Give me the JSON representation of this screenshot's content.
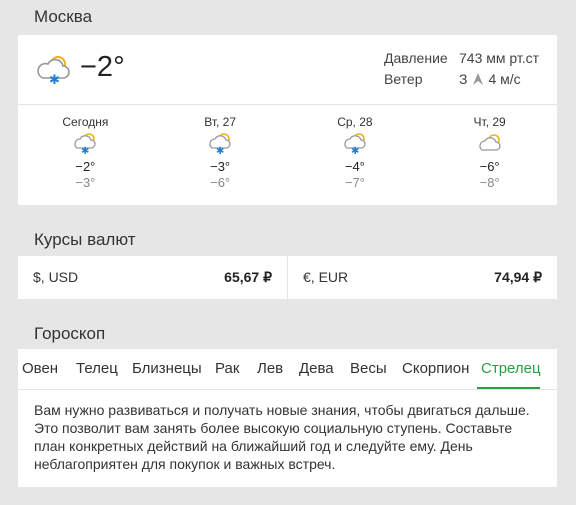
{
  "weather": {
    "city": "Москва",
    "current_temp": "−2°",
    "current_icon": "cloud-snow-sun-icon",
    "pressure_label": "Давление",
    "pressure_value": "743 мм рт.ст",
    "wind_label": "Ветер",
    "wind_dir": "З",
    "wind_speed": "4 м/с",
    "forecast": [
      {
        "day": "Сегодня",
        "icon": "cloud-snow-sun-icon",
        "hi": "−2°",
        "lo": "−3°"
      },
      {
        "day": "Вт, 27",
        "icon": "cloud-snow-sun-icon",
        "hi": "−3°",
        "lo": "−6°"
      },
      {
        "day": "Ср, 28",
        "icon": "cloud-snow-sun-icon",
        "hi": "−4°",
        "lo": "−7°"
      },
      {
        "day": "Чт, 29",
        "icon": "cloud-sun-icon",
        "hi": "−6°",
        "lo": "−8°"
      }
    ]
  },
  "currency": {
    "title": "Курсы валют",
    "items": [
      {
        "name": "$, USD",
        "value": "65,67 ₽"
      },
      {
        "name": "€, EUR",
        "value": "74,94 ₽"
      }
    ]
  },
  "horoscope": {
    "title": "Гороскоп",
    "tabs": [
      "Овен",
      "Телец",
      "Близнецы",
      "Рак",
      "Лев",
      "Дева",
      "Весы",
      "Скорпион",
      "Стрелец"
    ],
    "active_tab": "Стрелец",
    "text": "Вам нужно развиваться и получать новые знания, чтобы двигаться дальше. Это позволит вам занять более высокую социальную ступень. Составьте план конкретных действий на ближайший год и следуйте ему. День неблагоприятен для покупок и важных встреч."
  },
  "colors": {
    "accent": "#2aa043",
    "snow": "#1e7fd6",
    "sun": "#f3b01c",
    "background": "#e6e6e6"
  }
}
